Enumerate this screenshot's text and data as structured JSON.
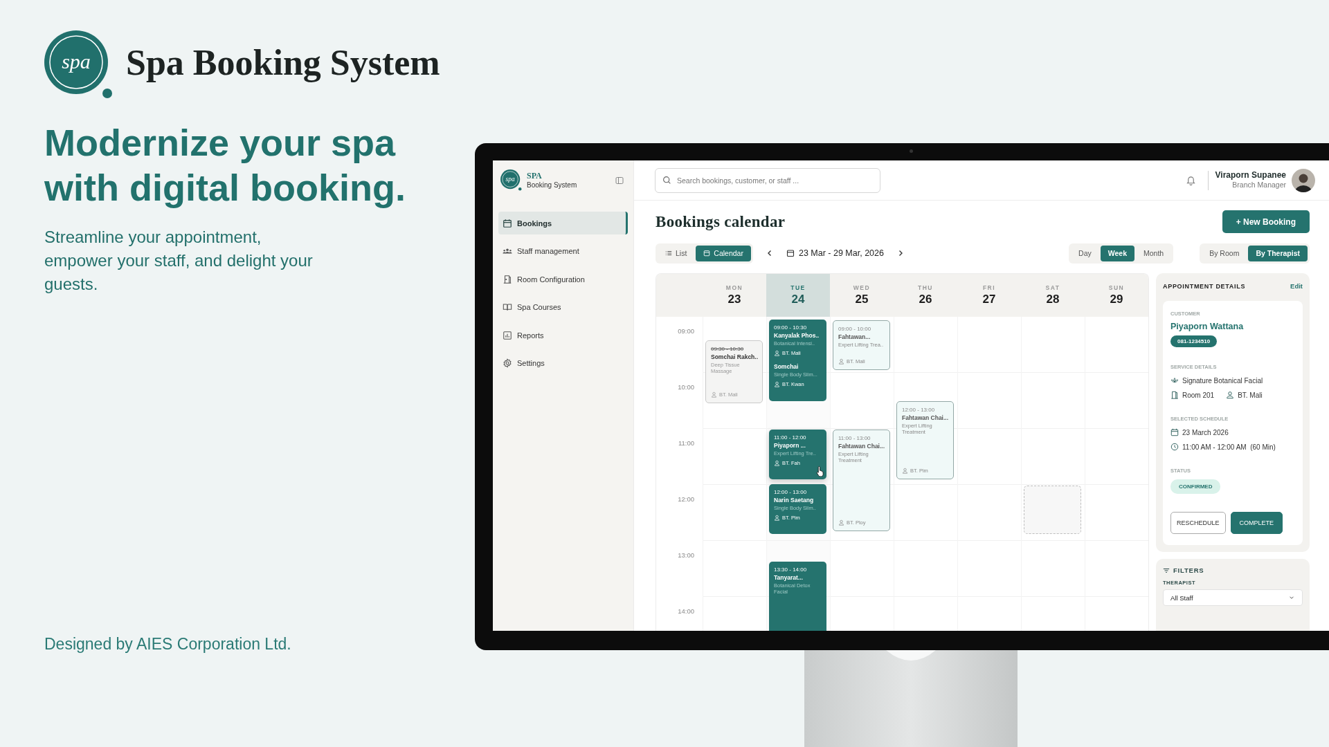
{
  "brand": {
    "logo_text": "spa",
    "title": "Spa Booking System"
  },
  "headline": "Modernize your spa with digital booking.",
  "tagline": [
    "Streamline your appointment,",
    "empower your staff, and delight your",
    "guests."
  ],
  "credit": "Designed by AIES Corporation Ltd.",
  "app": {
    "sidebar": {
      "logo_text": "spa",
      "title": "SPA",
      "subtitle": "Booking System",
      "items": [
        {
          "label": "Bookings",
          "selected": true
        },
        {
          "label": "Staff management",
          "selected": false
        },
        {
          "label": "Room Configuration",
          "selected": false
        },
        {
          "label": "Spa Courses",
          "selected": false
        },
        {
          "label": "Reports",
          "selected": false
        },
        {
          "label": "Settings",
          "selected": false
        }
      ]
    },
    "topbar": {
      "search": {
        "placeholder": "Search bookings, customer, or staff ..."
      },
      "user_name": "Viraporn Supanee",
      "user_role": "Branch Manager"
    },
    "page_title": "Bookings calendar",
    "new_booking": "+ New Booking",
    "layouts": [
      {
        "label": "List",
        "selected": false
      },
      {
        "label": "Calendar",
        "selected": true
      }
    ],
    "date_range": "23 Mar - 29 Mar, 2026",
    "views": [
      {
        "label": "Day",
        "selected": false
      },
      {
        "label": "Week",
        "selected": true
      },
      {
        "label": "Month",
        "selected": false
      }
    ],
    "groupings": [
      {
        "label": "By Room",
        "selected": false
      },
      {
        "label": "By Therapist",
        "selected": true
      }
    ],
    "calendar": {
      "hours": [
        "09:00",
        "10:00",
        "11:00",
        "12:00",
        "13:00",
        "14:00"
      ],
      "days": [
        {
          "weekday": "MON",
          "date": "23",
          "selected": false,
          "events": [
            {
              "kind": "cancelled",
              "selected": false,
              "entries": [
                {
                  "time": "09:30 - 10:30",
                  "name": "Somchai Rakch..",
                  "service": "Deep Tissue Massage",
                  "therapist": "BT. Mali"
                }
              ]
            }
          ]
        },
        {
          "weekday": "TUE",
          "date": "24",
          "selected": true,
          "events": [
            {
              "kind": "confirmed",
              "selected": false,
              "entries": [
                {
                  "time": "09:00 - 10:30",
                  "name": "Kanyalak Phos..",
                  "service": "Botanical Intensi..",
                  "therapist": "BT. Mali"
                },
                {
                  "name": "Somchai",
                  "service": "Single Body Slim...",
                  "therapist": "BT. Kwan"
                }
              ]
            },
            {
              "kind": "confirmed",
              "selected": true,
              "entries": [
                {
                  "time": "11:00 - 12:00",
                  "name": "Piyaporn ...",
                  "service": "Expert Lifting Tre..",
                  "therapist": "BT. Fah"
                }
              ]
            },
            {
              "kind": "confirmed",
              "selected": false,
              "entries": [
                {
                  "time": "12:00 - 13:00",
                  "name": "Narin Saetang",
                  "service": "Single Body Slim..",
                  "therapist": "BT. Pim"
                }
              ]
            },
            {
              "kind": "confirmed",
              "selected": false,
              "entries": [
                {
                  "time": "13:30 - 14:00",
                  "name": "Tanyarat...",
                  "service": "Botanical Detox Facial"
                }
              ]
            }
          ]
        },
        {
          "weekday": "WED",
          "date": "25",
          "selected": false,
          "events": [
            {
              "kind": "pending",
              "selected": false,
              "entries": [
                {
                  "time": "09:00 - 10:00",
                  "name": "Fahtawan...",
                  "service": "Expert Lifting Trea..",
                  "therapist": "BT. Mali"
                }
              ]
            },
            {
              "kind": "pending",
              "selected": false,
              "entries": [
                {
                  "time": "11:00 - 13:00",
                  "name": "Fahtawan Chai...",
                  "service": "Expert Lifting Treatment",
                  "therapist": "BT. Ploy"
                }
              ]
            }
          ]
        },
        {
          "weekday": "THU",
          "date": "26",
          "selected": false,
          "events": [
            {
              "kind": "pending",
              "selected": false,
              "entries": [
                {
                  "time": "12:00 - 13:00",
                  "name": "Fahtawan Chai...",
                  "service": "Expert Lifting Treatment",
                  "therapist": "BT. Pim"
                }
              ]
            }
          ]
        },
        {
          "weekday": "FRI",
          "date": "27",
          "selected": false
        },
        {
          "weekday": "SAT",
          "date": "28",
          "selected": false,
          "events": [
            {
              "kind": "placeholder",
              "selected": false
            }
          ]
        },
        {
          "weekday": "SUN",
          "date": "29",
          "selected": false
        }
      ]
    },
    "details": {
      "title": "APPOINTMENT DETAILS",
      "edit": "Edit",
      "customer_label": "CUSTOMER",
      "customer_name": "Piyaporn Wattana",
      "phone": "081-1234510",
      "service_label": "SERVICE DETAILS",
      "service": "Signature Botanical Facial",
      "room": "Room 201",
      "therapist": "BT. Mali",
      "schedule_label": "SELECTED SCHEDULE",
      "date": "23 March 2026",
      "time": "11:00 AM - 12:00 AM  (60 Min)",
      "status_label": "STATUS",
      "status": "CONFIRMED",
      "buttons": [
        {
          "label": "RESCHEDULE",
          "kind": "secondary"
        },
        {
          "label": "COMPLETE",
          "kind": "primary"
        }
      ]
    },
    "filters": {
      "title": "FILTERS",
      "therapist_label": "THERAPIST",
      "therapist_value": "All Staff"
    }
  }
}
